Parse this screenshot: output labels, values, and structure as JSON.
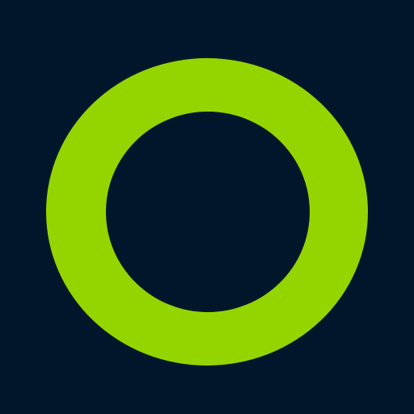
{
  "logo": {
    "icon": "ring-logo-icon",
    "colors": {
      "background": "#00172B",
      "ring": "#94D500"
    }
  }
}
